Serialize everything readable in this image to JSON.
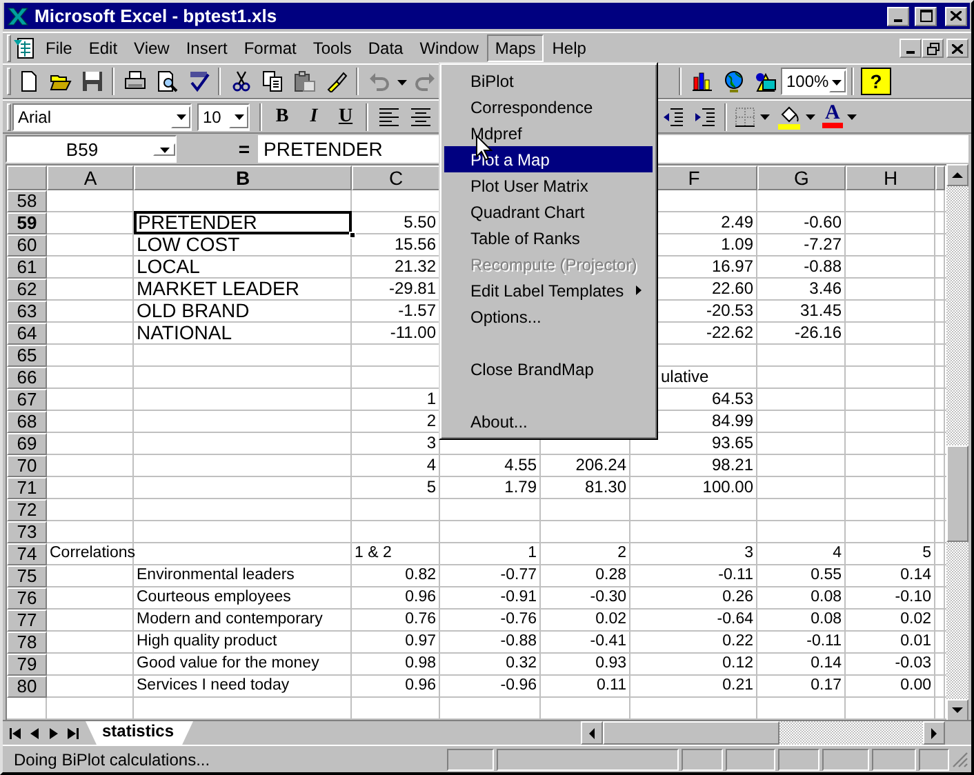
{
  "window": {
    "title": "Microsoft Excel - bptest1.xls"
  },
  "menu_bar": [
    {
      "label": "File",
      "selected": false
    },
    {
      "label": "Edit",
      "selected": false
    },
    {
      "label": "View",
      "selected": false
    },
    {
      "label": "Insert",
      "selected": false
    },
    {
      "label": "Format",
      "selected": false
    },
    {
      "label": "Tools",
      "selected": false
    },
    {
      "label": "Data",
      "selected": false
    },
    {
      "label": "Window",
      "selected": false
    },
    {
      "label": "Maps",
      "selected": true
    },
    {
      "label": "Help",
      "selected": false
    }
  ],
  "toolbar": {
    "zoom": "100%",
    "help": "?"
  },
  "format_bar": {
    "font": "Arial",
    "size": "10",
    "bold": "B",
    "italic": "I",
    "underline": "U",
    "font_color": "A"
  },
  "formula_bar": {
    "name_box": "B59",
    "equals": "=",
    "value": "PRETENDER"
  },
  "columns": [
    {
      "label": "A",
      "selected": false
    },
    {
      "label": "B",
      "selected": true
    },
    {
      "label": "C",
      "selected": false
    },
    {
      "label": "F",
      "selected": false
    },
    {
      "label": "G",
      "selected": false
    },
    {
      "label": "H",
      "selected": false
    }
  ],
  "rows": [
    {
      "number": "58",
      "selected": false,
      "kind": "plain"
    },
    {
      "number": "59",
      "selected": true,
      "kind": "brand",
      "labels": {
        "B": "PRETENDER"
      },
      "values": {
        "C": "5.50",
        "F": "2.49",
        "G": "-0.60"
      }
    },
    {
      "number": "60",
      "selected": false,
      "kind": "brand",
      "labels": {
        "B": "LOW COST"
      },
      "values": {
        "C": "15.56",
        "F": "1.09",
        "G": "-7.27"
      }
    },
    {
      "number": "61",
      "selected": false,
      "kind": "brand",
      "labels": {
        "B": "LOCAL"
      },
      "values": {
        "C": "21.32",
        "F": "16.97",
        "G": "-0.88"
      }
    },
    {
      "number": "62",
      "selected": false,
      "kind": "brand",
      "labels": {
        "B": "MARKET LEADER"
      },
      "values": {
        "C": "-29.81",
        "F": "22.60",
        "G": "3.46"
      }
    },
    {
      "number": "63",
      "selected": false,
      "kind": "brand",
      "labels": {
        "B": "OLD BRAND"
      },
      "values": {
        "C": "-1.57",
        "F": "-20.53",
        "G": "31.45"
      }
    },
    {
      "number": "64",
      "selected": false,
      "kind": "brand",
      "labels": {
        "B": "NATIONAL"
      },
      "values": {
        "C": "-11.00",
        "F": "-22.62",
        "G": "-26.16"
      }
    },
    {
      "number": "65",
      "selected": false,
      "kind": "plain"
    },
    {
      "number": "66",
      "selected": false,
      "kind": "plain",
      "caption": "ulative"
    },
    {
      "number": "67",
      "selected": false,
      "kind": "plain",
      "values": {
        "C": "1",
        "F": "64.53"
      }
    },
    {
      "number": "68",
      "selected": false,
      "kind": "plain",
      "values": {
        "C": "2",
        "F": "84.99"
      }
    },
    {
      "number": "69",
      "selected": false,
      "kind": "plain",
      "values": {
        "C": "3",
        "F": "93.65"
      }
    },
    {
      "number": "70",
      "selected": false,
      "kind": "plain",
      "values": {
        "C": "4",
        "D": "4.55",
        "E": "206.24",
        "F": "98.21"
      }
    },
    {
      "number": "71",
      "selected": false,
      "kind": "plain",
      "values": {
        "C": "5",
        "D": "1.79",
        "E": "81.30",
        "F": "100.00"
      }
    },
    {
      "number": "72",
      "selected": false,
      "kind": "plain"
    },
    {
      "number": "73",
      "selected": false,
      "kind": "plain"
    },
    {
      "number": "74",
      "selected": false,
      "kind": "small",
      "labels": {
        "A": "Correlations",
        "C": "1 & 2"
      },
      "values": {
        "D": "1",
        "E": "2",
        "F": "3",
        "G": "4",
        "H": "5"
      }
    },
    {
      "number": "75",
      "selected": false,
      "kind": "small",
      "labels": {
        "B": "Environmental leaders"
      },
      "values": {
        "C": "0.82",
        "D": "-0.77",
        "E": "0.28",
        "F": "-0.11",
        "G": "0.55",
        "H": "0.14"
      }
    },
    {
      "number": "76",
      "selected": false,
      "kind": "small",
      "labels": {
        "B": "Courteous employees"
      },
      "values": {
        "C": "0.96",
        "D": "-0.91",
        "E": "-0.30",
        "F": "0.26",
        "G": "0.08",
        "H": "-0.10"
      }
    },
    {
      "number": "77",
      "selected": false,
      "kind": "small",
      "labels": {
        "B": "Modern and contemporary"
      },
      "values": {
        "C": "0.76",
        "D": "-0.76",
        "E": "0.02",
        "F": "-0.64",
        "G": "0.08",
        "H": "0.02"
      }
    },
    {
      "number": "78",
      "selected": false,
      "kind": "small",
      "labels": {
        "B": "High quality product"
      },
      "values": {
        "C": "0.97",
        "D": "-0.88",
        "E": "-0.41",
        "F": "0.22",
        "G": "-0.11",
        "H": "0.01"
      }
    },
    {
      "number": "79",
      "selected": false,
      "kind": "small",
      "labels": {
        "B": "Good value for the money"
      },
      "values": {
        "C": "0.98",
        "D": "0.32",
        "E": "0.93",
        "F": "0.12",
        "G": "0.14",
        "H": "-0.03"
      }
    },
    {
      "number": "80",
      "selected": false,
      "kind": "small",
      "labels": {
        "B": "Services I need today"
      },
      "values": {
        "C": "0.96",
        "D": "-0.96",
        "E": "0.11",
        "F": "0.21",
        "G": "0.17",
        "H": "0.00"
      }
    }
  ],
  "sheet_tabs": [
    {
      "label": "statistics",
      "selected": true
    }
  ],
  "status_bar": {
    "text": "Doing BiPlot calculations..."
  },
  "maps_menu": {
    "groups": [
      [
        {
          "label": "BiPlot",
          "kind": "item",
          "selected": false,
          "disabled": false
        },
        {
          "label": "Correspondence",
          "kind": "item",
          "selected": false,
          "disabled": false
        },
        {
          "label": "Mdpref",
          "kind": "item",
          "selected": false,
          "disabled": false
        },
        {
          "label": "Plot a Map",
          "kind": "item",
          "selected": true,
          "disabled": false
        },
        {
          "label": "Plot User Matrix",
          "kind": "item",
          "selected": false,
          "disabled": false
        },
        {
          "label": "Quadrant Chart",
          "kind": "item",
          "selected": false,
          "disabled": false
        },
        {
          "label": "Table of Ranks",
          "kind": "item",
          "selected": false,
          "disabled": false
        },
        {
          "label": "Recompute (Projector)",
          "kind": "item",
          "selected": false,
          "disabled": true
        },
        {
          "label": "Edit Label Templates",
          "kind": "submenu",
          "selected": false,
          "disabled": false
        },
        {
          "label": "Options...",
          "kind": "item",
          "selected": false,
          "disabled": false
        }
      ],
      [
        {
          "label": "Close BrandMap",
          "kind": "item",
          "selected": false,
          "disabled": false
        }
      ],
      [
        {
          "label": "About...",
          "kind": "item",
          "selected": false,
          "disabled": false
        }
      ]
    ]
  }
}
